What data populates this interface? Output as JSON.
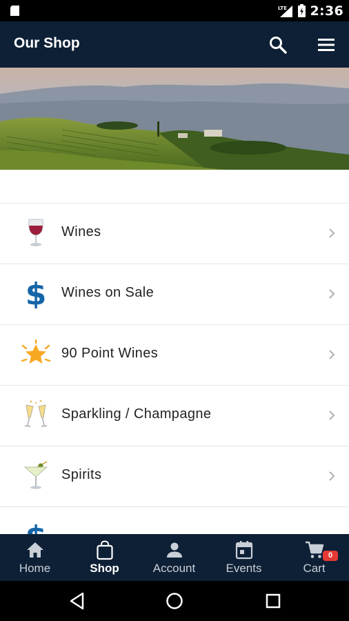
{
  "status_bar": {
    "time": "2:36",
    "network": "LTE"
  },
  "app_bar": {
    "title": "Our Shop"
  },
  "menu": {
    "items": [
      {
        "label": "Wines",
        "icon": "wine-glass-icon"
      },
      {
        "label": "Wines on Sale",
        "icon": "dollar-sign-icon"
      },
      {
        "label": "90 Point Wines",
        "icon": "star-burst-icon"
      },
      {
        "label": "Sparkling / Champagne",
        "icon": "champagne-glasses-icon"
      },
      {
        "label": "Spirits",
        "icon": "cocktail-glass-icon"
      },
      {
        "label": "",
        "icon": "dollar-sign-icon"
      }
    ]
  },
  "bottom_nav": {
    "items": [
      {
        "label": "Home",
        "icon": "home-icon"
      },
      {
        "label": "Shop",
        "icon": "shopping-bag-icon",
        "active": true
      },
      {
        "label": "Account",
        "icon": "person-icon"
      },
      {
        "label": "Events",
        "icon": "calendar-icon"
      },
      {
        "label": "Cart",
        "icon": "cart-icon",
        "badge": "0"
      }
    ]
  },
  "colors": {
    "header_bg": "#0d2036",
    "dollar_blue": "#1565a8",
    "badge_red": "#e53935",
    "wine_red": "#9c1e3c",
    "star_orange": "#f7a823"
  }
}
